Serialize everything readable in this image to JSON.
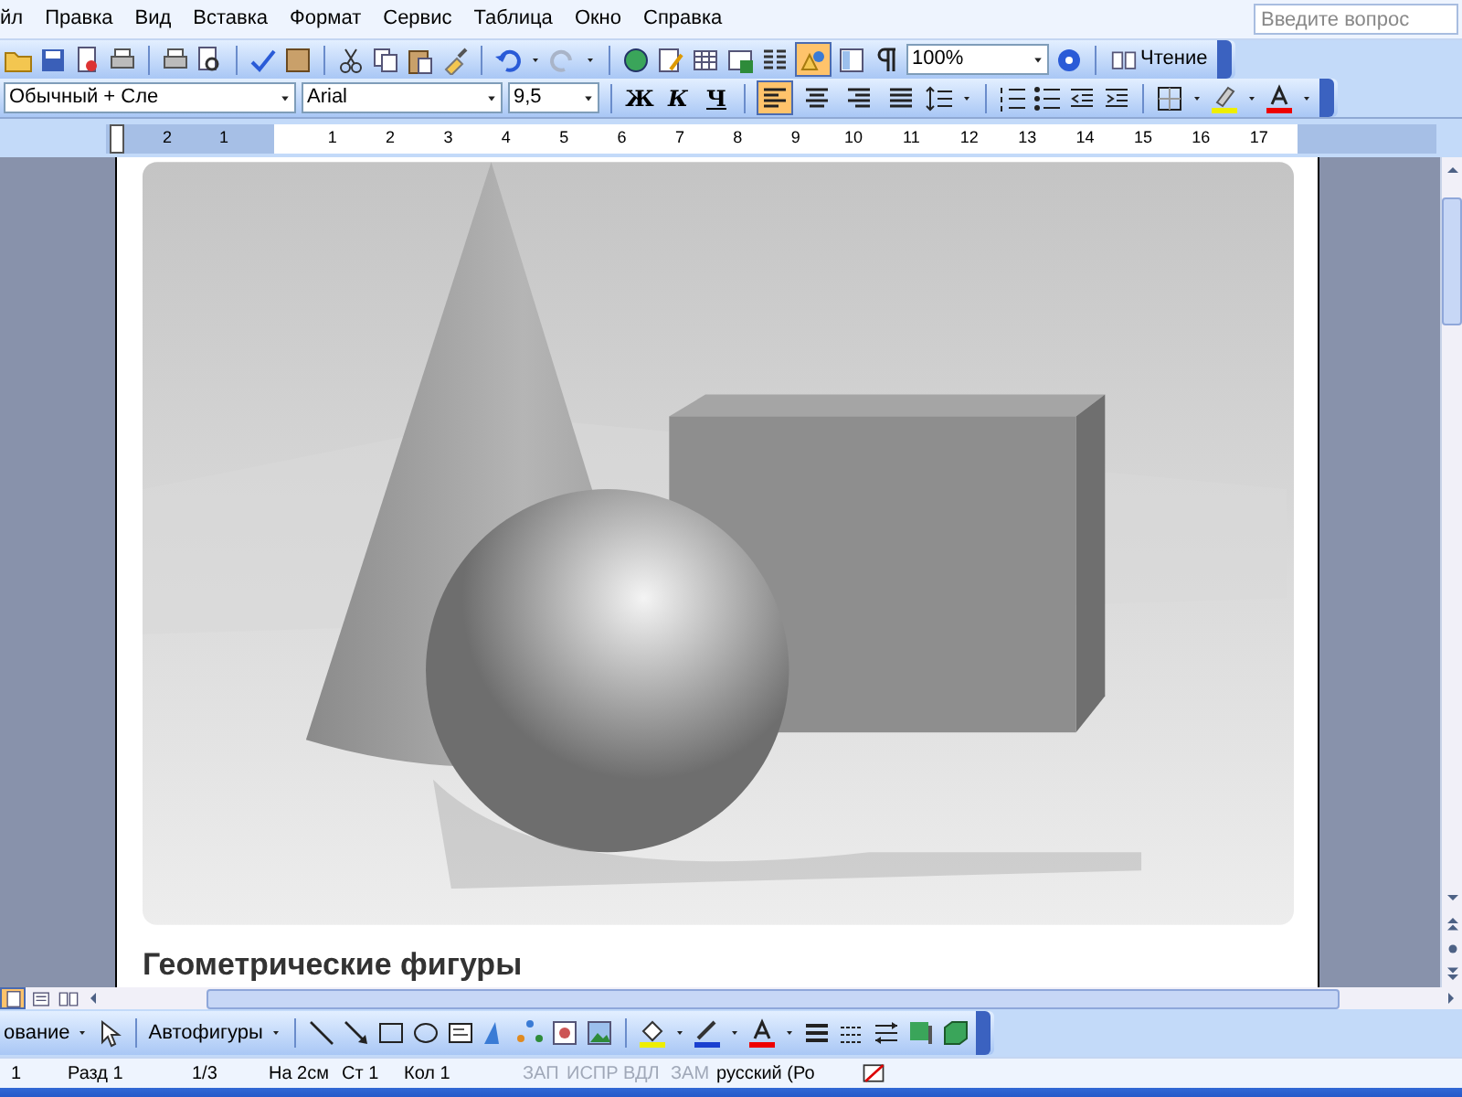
{
  "menu": {
    "items": [
      "йл",
      "Правка",
      "Вид",
      "Вставка",
      "Формат",
      "Сервис",
      "Таблица",
      "Окно",
      "Справка"
    ],
    "help_field": {
      "placeholder": "Введите вопрос"
    }
  },
  "standard_toolbar": {
    "drawing_button": {
      "selected": true
    },
    "zoom": "100%",
    "reading_button": "Чтение"
  },
  "formatting_toolbar": {
    "style": "Обычный + Сле",
    "font": "Arial",
    "size": "9,5",
    "text_buttons": [
      "Ж",
      "К",
      "Ч"
    ],
    "alignment": [
      {
        "selected": true
      },
      {
        "selected": false
      },
      {
        "selected": false
      },
      {
        "selected": false
      }
    ]
  },
  "ruler": {
    "left_labels": [
      "2",
      "1"
    ],
    "right_labels": [
      "1",
      "2",
      "3",
      "4",
      "5",
      "6",
      "7",
      "8",
      "9",
      "10",
      "11",
      "12",
      "13",
      "14",
      "15",
      "16",
      "17"
    ]
  },
  "document": {
    "caption": "Геометрические фигуры"
  },
  "view_buttons": [
    {
      "selected": true
    },
    {
      "selected": false
    },
    {
      "selected": false
    }
  ],
  "drawing_toolbar": {
    "draw_menu": "ование",
    "autoshapes": "Автофигуры"
  },
  "status_bar": [
    {
      "text": "1",
      "disabled": false
    },
    {
      "text": "Разд 1",
      "disabled": false
    },
    {
      "text": "1/3",
      "disabled": false
    },
    {
      "text": "На 2см",
      "disabled": false
    },
    {
      "text": "Ст 1",
      "disabled": false
    },
    {
      "text": "Кол 1",
      "disabled": false
    },
    {
      "text": "ЗАП",
      "disabled": true
    },
    {
      "text": "ИСПР",
      "disabled": true
    },
    {
      "text": "ВДЛ",
      "disabled": true
    },
    {
      "text": "ЗАМ",
      "disabled": true
    },
    {
      "text": "русский (Ро",
      "disabled": false
    }
  ]
}
